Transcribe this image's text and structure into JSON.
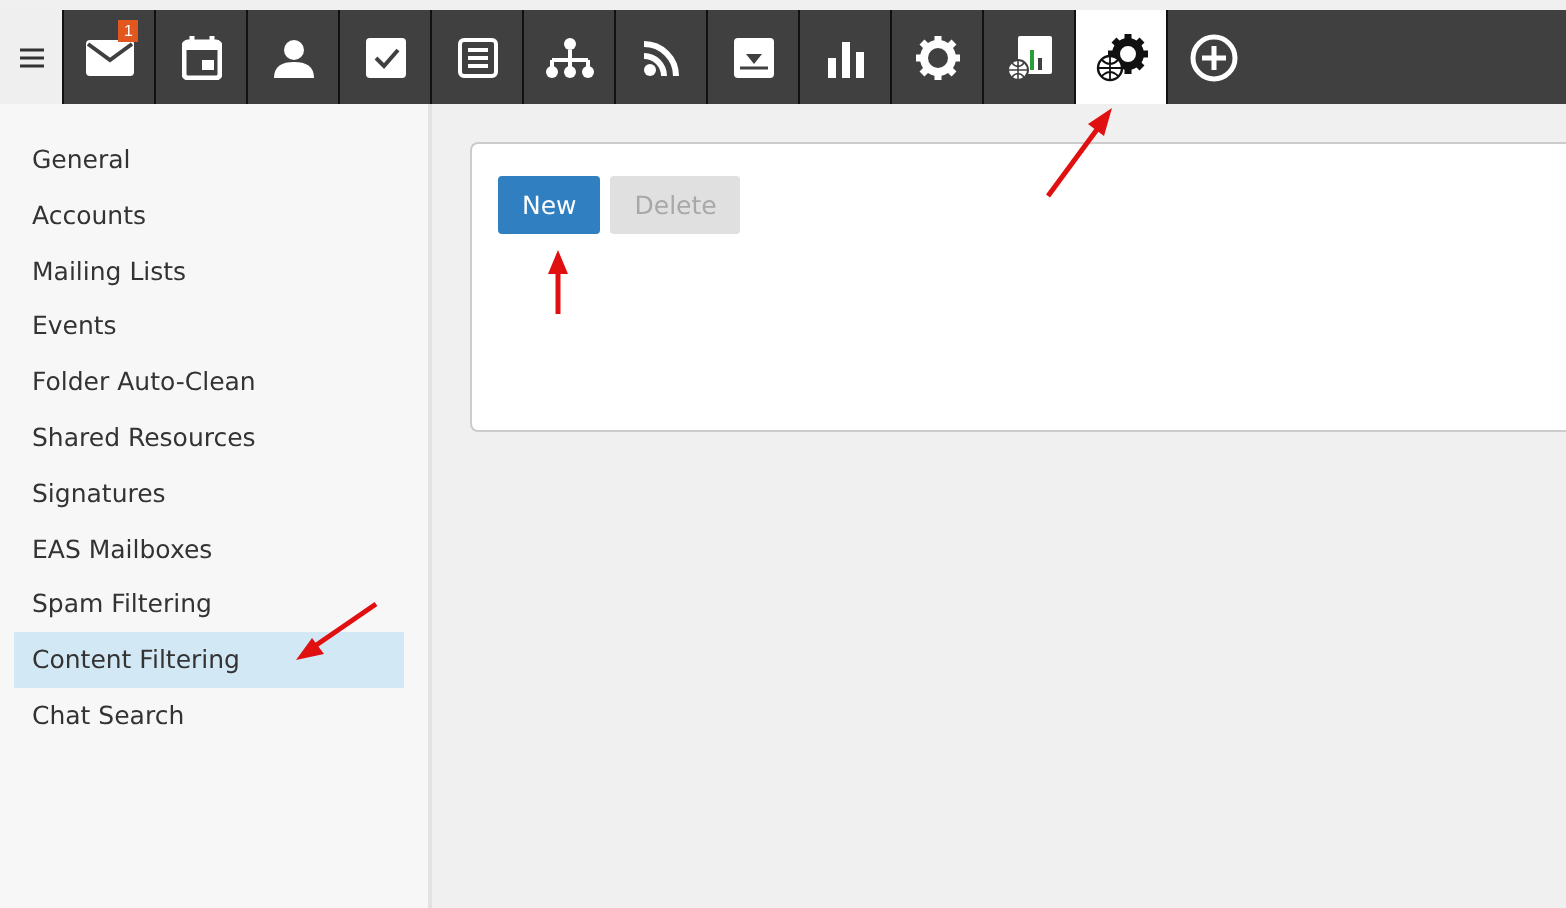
{
  "toolbar": [
    {
      "kind": "mail",
      "selected": false,
      "badge": "1"
    },
    {
      "kind": "calendar",
      "selected": false
    },
    {
      "kind": "contact",
      "selected": false
    },
    {
      "kind": "task",
      "selected": false
    },
    {
      "kind": "note",
      "selected": false
    },
    {
      "kind": "tree",
      "selected": false
    },
    {
      "kind": "rss",
      "selected": false
    },
    {
      "kind": "download",
      "selected": false
    },
    {
      "kind": "chart",
      "selected": false
    },
    {
      "kind": "gear",
      "selected": false
    },
    {
      "kind": "chartglobe",
      "selected": false
    },
    {
      "kind": "gearglobe",
      "selected": true
    },
    {
      "kind": "plus",
      "selected": false
    }
  ],
  "sidebar": {
    "items": [
      {
        "label": "General",
        "selected": false
      },
      {
        "label": "Accounts",
        "selected": false
      },
      {
        "label": "Mailing Lists",
        "selected": false
      },
      {
        "label": "Events",
        "selected": false
      },
      {
        "label": "Folder Auto-Clean",
        "selected": false
      },
      {
        "label": "Shared Resources",
        "selected": false
      },
      {
        "label": "Signatures",
        "selected": false
      },
      {
        "label": "EAS Mailboxes",
        "selected": false
      },
      {
        "label": "Spam Filtering",
        "selected": false
      },
      {
        "label": "Content Filtering",
        "selected": true
      },
      {
        "label": "Chat Search",
        "selected": false
      }
    ]
  },
  "buttons": [
    {
      "label": "New",
      "disabled": false
    },
    {
      "label": "Delete",
      "disabled": true
    }
  ]
}
